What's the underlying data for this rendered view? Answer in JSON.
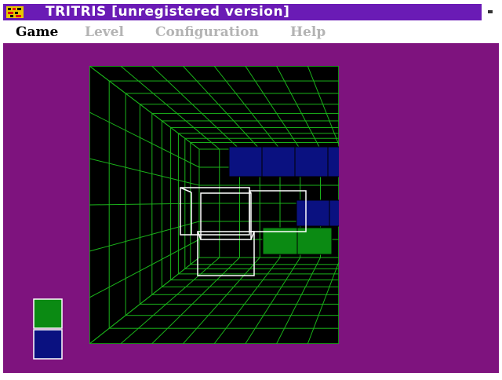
{
  "window": {
    "title": "TRITRIS [unregistered version]",
    "icon": "tritris-app-icon",
    "system_button_icon": "window-control-icon"
  },
  "menu": {
    "items": [
      {
        "label": "Game",
        "enabled": true
      },
      {
        "label": "Level",
        "enabled": false
      },
      {
        "label": "Configuration",
        "enabled": false
      },
      {
        "label": "Help",
        "enabled": false
      }
    ]
  },
  "colors": {
    "title_bar": "#6a1bb5",
    "background": "#7e137e",
    "pit_floor": "#000000",
    "grid_lines": "#1ab21a",
    "block_blue": "#0a1180",
    "block_green": "#0b8a13",
    "falling_piece_outline": "#ffffff",
    "preview_frame": "#ffffff"
  },
  "pit": {
    "view": "3d-perspective-well",
    "placed_blocks": [
      {
        "color": "blue",
        "count": 4
      },
      {
        "color": "blue",
        "count": 2
      },
      {
        "color": "green",
        "count": 2
      }
    ],
    "falling_piece": {
      "style": "white-wireframe"
    }
  },
  "next_piece": {
    "cells": [
      "green",
      "blue"
    ]
  }
}
